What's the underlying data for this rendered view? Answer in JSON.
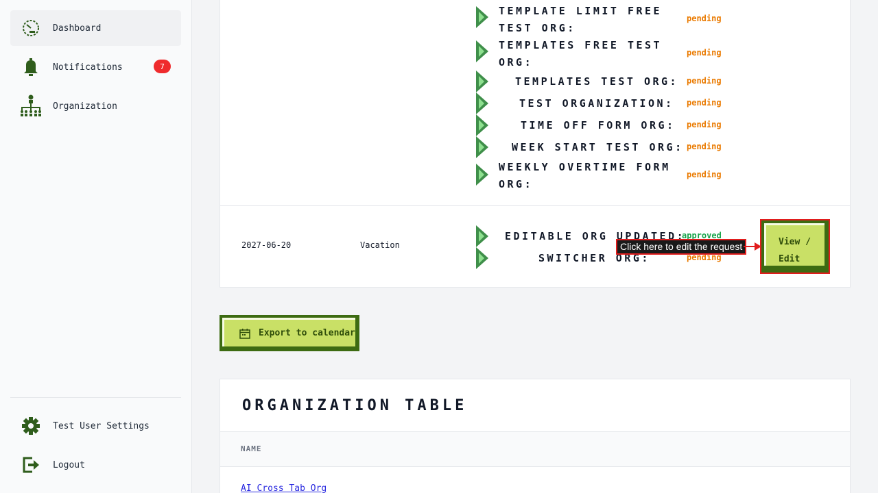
{
  "sidebar": {
    "items": [
      {
        "label": "Dashboard",
        "icon": "dashboard-gauge-icon"
      },
      {
        "label": "Notifications",
        "icon": "bell-icon",
        "badge": "7"
      },
      {
        "label": "Organization",
        "icon": "org-chart-icon"
      }
    ],
    "bottom": [
      {
        "label": "Test User Settings",
        "icon": "gear-icon"
      },
      {
        "label": "Logout",
        "icon": "logout-icon"
      }
    ]
  },
  "request_1": {
    "orgs": [
      {
        "name": "Template Limit Free Test Org:",
        "status": "pending"
      },
      {
        "name": "Templates Free Test Org:",
        "status": "pending"
      },
      {
        "name": "Templates Test Org:",
        "status": "pending"
      },
      {
        "name": "Test Organization:",
        "status": "pending"
      },
      {
        "name": "Time Off Form Org:",
        "status": "pending"
      },
      {
        "name": "Week Start Test Org:",
        "status": "pending"
      },
      {
        "name": "Weekly Overtime Form Org:",
        "status": "pending"
      }
    ]
  },
  "request_2": {
    "date": "2027-06-20",
    "type": "Vacation",
    "orgs": [
      {
        "name": "Editable Org Updated:",
        "status": "approved"
      },
      {
        "name": "Switcher Org:",
        "status": "pending"
      }
    ],
    "view_edit_label": "View / Edit",
    "tooltip": "Click here to edit the request"
  },
  "export_label": "Export to calendar",
  "org_table": {
    "title": "Organization Table",
    "column_name": "NAME",
    "rows": [
      "AI Cross Tab Org"
    ]
  },
  "colors": {
    "accent_dark_green": "#3d6b12",
    "button_lime": "#c9e066",
    "pending": "#ea7a00",
    "approved": "#16a34a",
    "badge_red": "#ef2b2d",
    "link_blue": "#2a2ae0"
  }
}
